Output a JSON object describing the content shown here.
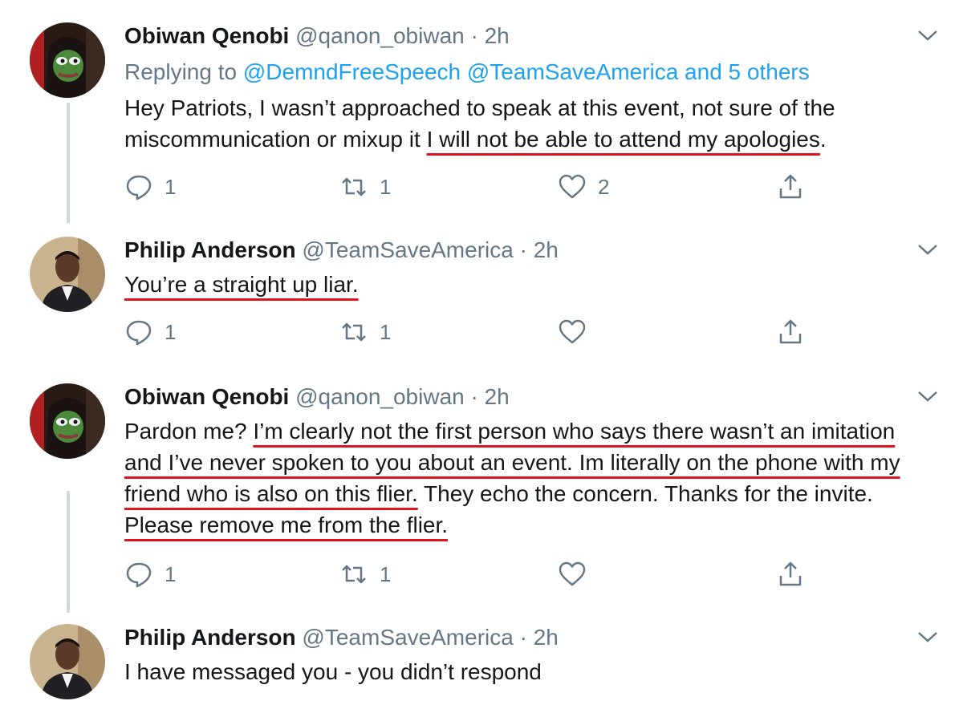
{
  "tweets": [
    {
      "name": "Obiwan Qenobi",
      "handle": "@qanon_obiwan",
      "separator": "·",
      "time": "2h",
      "replying": {
        "prefix": "Replying to",
        "mentions": "@DemndFreeSpeech @TeamSaveAmerica and 5 others"
      },
      "text_plain_1": "Hey Patriots, I wasn’t approached to speak at this event, not sure of the miscommunication or mixup it ",
      "text_underlined_1": "I will not be able to attend my apologies",
      "text_plain_2": ".",
      "reply_count": "1",
      "retweet_count": "1",
      "like_count": "2",
      "avatar_icon": "pepe-avatar-icon"
    },
    {
      "name": "Philip Anderson",
      "handle": "@TeamSaveAmerica",
      "separator": "·",
      "time": "2h",
      "text_underlined_1": "You’re a straight up liar.",
      "reply_count": "1",
      "retweet_count": "1",
      "like_count": "",
      "avatar_icon": "person-avatar-icon"
    },
    {
      "name": "Obiwan Qenobi",
      "handle": "@qanon_obiwan",
      "separator": "·",
      "time": "2h",
      "text_plain_1": "Pardon me? ",
      "text_underlined_1": "I’m clearly not the first person who says there wasn’t an imitation and I’ve never spoken to you about an event. Im literally on the phone with my friend who is also on this flier.",
      "text_plain_2": " They echo the concern. Thanks for the invite. ",
      "text_underlined_2": "Please remove me from the flier.",
      "reply_count": "1",
      "retweet_count": "1",
      "like_count": "",
      "avatar_icon": "pepe-avatar-icon"
    },
    {
      "name": "Philip Anderson",
      "handle": "@TeamSaveAmerica",
      "separator": "·",
      "time": "2h",
      "text_plain_1": "I have messaged you - you didn’t respond",
      "avatar_icon": "person-avatar-icon"
    }
  ],
  "colors": {
    "link": "#1da1f2",
    "secondary": "#657786",
    "underline": "#e0141e",
    "thread": "#cfd9de"
  }
}
